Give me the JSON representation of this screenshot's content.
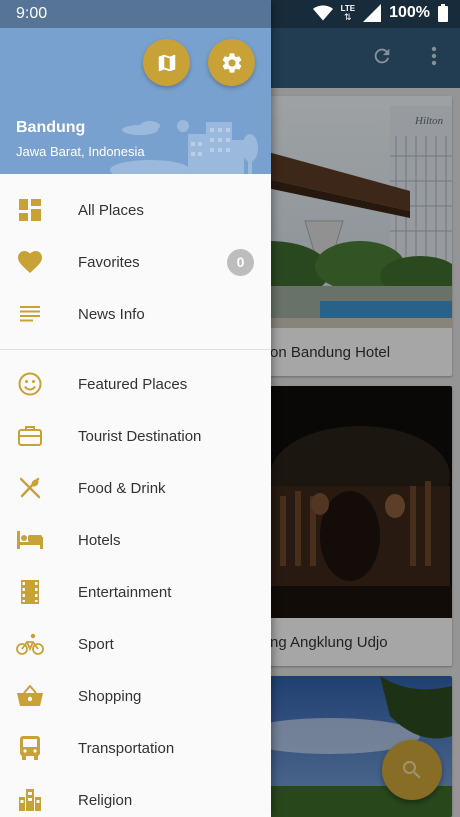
{
  "status": {
    "time": "9:00",
    "network": "LTE",
    "battery": "100%"
  },
  "header": {
    "city": "Bandung",
    "region": "Jawa Barat, Indonesia",
    "map_button_icon": "map-icon",
    "settings_button_icon": "settings-icon"
  },
  "menu": {
    "primary": [
      {
        "label": "All Places",
        "icon": "dashboard-icon"
      },
      {
        "label": "Favorites",
        "icon": "heart-icon",
        "badge": "0"
      },
      {
        "label": "News Info",
        "icon": "subject-icon"
      }
    ],
    "categories": [
      {
        "label": "Featured Places",
        "icon": "smiley-icon"
      },
      {
        "label": "Tourist Destination",
        "icon": "briefcase-icon"
      },
      {
        "label": "Food & Drink",
        "icon": "utensils-icon"
      },
      {
        "label": "Hotels",
        "icon": "bed-icon"
      },
      {
        "label": "Entertainment",
        "icon": "film-icon"
      },
      {
        "label": "Sport",
        "icon": "bike-icon"
      },
      {
        "label": "Shopping",
        "icon": "basket-icon"
      },
      {
        "label": "Transportation",
        "icon": "bus-icon"
      },
      {
        "label": "Religion",
        "icon": "building-icon"
      }
    ]
  },
  "background": {
    "cards": [
      {
        "caption": "on Bandung Hotel"
      },
      {
        "caption": "ng Angklung Udjo"
      }
    ],
    "photo_sign": "Hilton"
  },
  "colors": {
    "accent": "#c8a137",
    "header": "#78a1cf",
    "appbar": "#33597a"
  }
}
